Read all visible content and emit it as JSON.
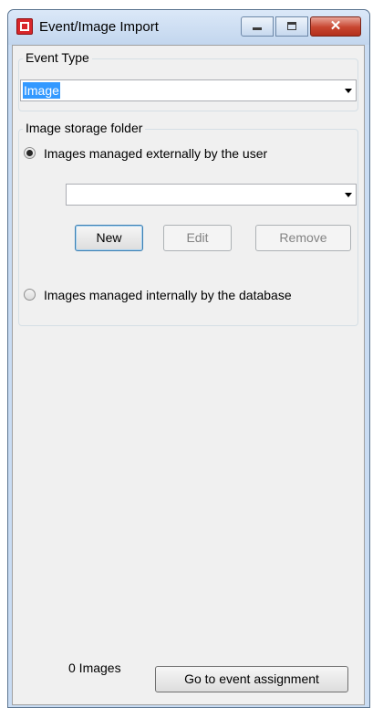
{
  "window": {
    "title": "Event/Image Import",
    "close_glyph": "✕"
  },
  "event_type": {
    "caption": "Event Type",
    "selected": "Image"
  },
  "storage": {
    "caption": "Image storage folder",
    "external_label": "Images managed externally by the user",
    "external_selected": true,
    "folder_value": "",
    "new_label": "New",
    "edit_label": "Edit",
    "remove_label": "Remove",
    "internal_label": "Images managed internally by the database",
    "internal_selected": false
  },
  "footer": {
    "image_count": "0 Images",
    "goto_label": "Go to event assignment"
  },
  "colors": {
    "title_bar": "#c9dcf3",
    "selection": "#3399ff",
    "close_button": "#c7452f"
  }
}
